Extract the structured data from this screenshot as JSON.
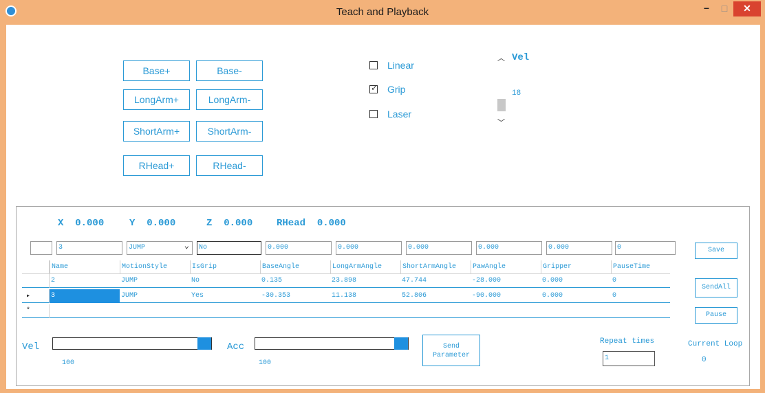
{
  "window": {
    "title": "Teach and Playback",
    "min": "−",
    "max": "□",
    "close": "✕"
  },
  "jog": {
    "base_plus": "Base+",
    "base_minus": "Base-",
    "longarm_plus": "LongArm+",
    "longarm_minus": "LongArm-",
    "shortarm_plus": "ShortArm+",
    "shortarm_minus": "ShortArm-",
    "rhead_plus": "RHead+",
    "rhead_minus": "RHead-"
  },
  "options": {
    "linear": {
      "label": "Linear",
      "checked": false
    },
    "grip": {
      "label": "Grip",
      "checked": true
    },
    "laser": {
      "label": "Laser",
      "checked": false
    }
  },
  "vel_box": {
    "title": "Vel",
    "value": "18"
  },
  "coords": {
    "x_label": "X",
    "x_value": "0.000",
    "y_label": "Y",
    "y_value": "0.000",
    "z_label": "Z",
    "z_value": "0.000",
    "rhead_label": "RHead",
    "rhead_value": "0.000"
  },
  "edit_row": {
    "name": "3",
    "motion_style": "JUMP",
    "is_grip": "No",
    "base_angle": "0.000",
    "longarm_angle": "0.000",
    "shortarm_angle": "0.000",
    "paw_angle": "0.000",
    "gripper": "0.000",
    "pause_time": "0"
  },
  "table": {
    "headers": [
      "Name",
      "MotionStyle",
      "IsGrip",
      "BaseAngle",
      "LongArmAngle",
      "ShortArmAngle",
      "PawAngle",
      "Gripper",
      "PauseTime"
    ],
    "rows": [
      {
        "marker": "",
        "cells": [
          "2",
          "JUMP",
          "No",
          "0.135",
          "23.898",
          "47.744",
          "-28.000",
          "0.000",
          "0"
        ]
      },
      {
        "marker": "▸",
        "cells": [
          "3",
          "JUMP",
          "Yes",
          "-30.353",
          "11.138",
          "52.806",
          "-90.000",
          "0.000",
          "0"
        ]
      },
      {
        "marker": "*",
        "cells": [
          "",
          "",
          "",
          "",
          "",
          "",
          "",
          "",
          ""
        ]
      }
    ]
  },
  "buttons": {
    "save": "Save",
    "send_all": "SendAll",
    "pause": "Pause"
  },
  "bottom": {
    "vel_label": "Vel",
    "vel_value": "100",
    "vel_level": 1.0,
    "acc_label": "Acc",
    "acc_value": "100",
    "acc_level": 1.0,
    "send_line1": "Send",
    "send_line2": "Parameter",
    "repeat_label": "Repeat times",
    "repeat_value": "1",
    "loop_label": "Current Loop",
    "loop_value": "0"
  },
  "colors": {
    "accent": "#2b9ad6",
    "selection": "#1e90e0",
    "titlebar": "#f3b27a",
    "close": "#d9432f"
  }
}
